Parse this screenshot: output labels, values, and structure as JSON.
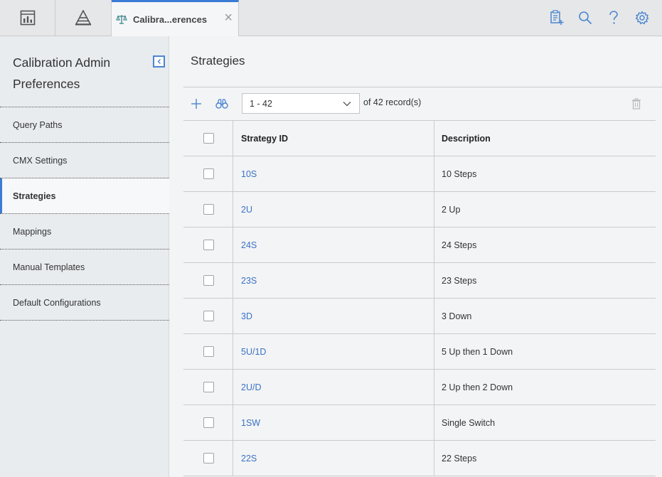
{
  "topbar": {
    "icons": [
      "dashboard-icon",
      "asset-hierarchy-icon"
    ],
    "tab": {
      "label": "Calibra...erences",
      "icon": "scale-icon"
    },
    "right_icons": [
      "new-document-icon",
      "search-icon",
      "help-icon",
      "settings-icon"
    ],
    "accent": "#3a7bd5"
  },
  "sidebar": {
    "title": "Calibration Admin Preferences",
    "items": [
      {
        "label": "Query Paths"
      },
      {
        "label": "CMX Settings"
      },
      {
        "label": "Strategies"
      },
      {
        "label": "Mappings"
      },
      {
        "label": "Manual Templates"
      },
      {
        "label": "Default Configurations"
      }
    ],
    "active": "Strategies"
  },
  "main": {
    "title": "Strategies",
    "pager": {
      "selected": "1 - 42",
      "of_text": "of 42 record(s)"
    },
    "table": {
      "columns": [
        "Strategy ID",
        "Description"
      ],
      "rows": [
        {
          "id": "10S",
          "desc": "10 Steps"
        },
        {
          "id": "2U",
          "desc": "2 Up"
        },
        {
          "id": "24S",
          "desc": "24 Steps"
        },
        {
          "id": "23S",
          "desc": "23 Steps"
        },
        {
          "id": "3D",
          "desc": "3 Down"
        },
        {
          "id": "5U/1D",
          "desc": "5 Up then 1 Down"
        },
        {
          "id": "2U/D",
          "desc": "2 Up then 2 Down"
        },
        {
          "id": "1SW",
          "desc": "Single Switch"
        },
        {
          "id": "22S",
          "desc": "22 Steps"
        }
      ]
    }
  }
}
